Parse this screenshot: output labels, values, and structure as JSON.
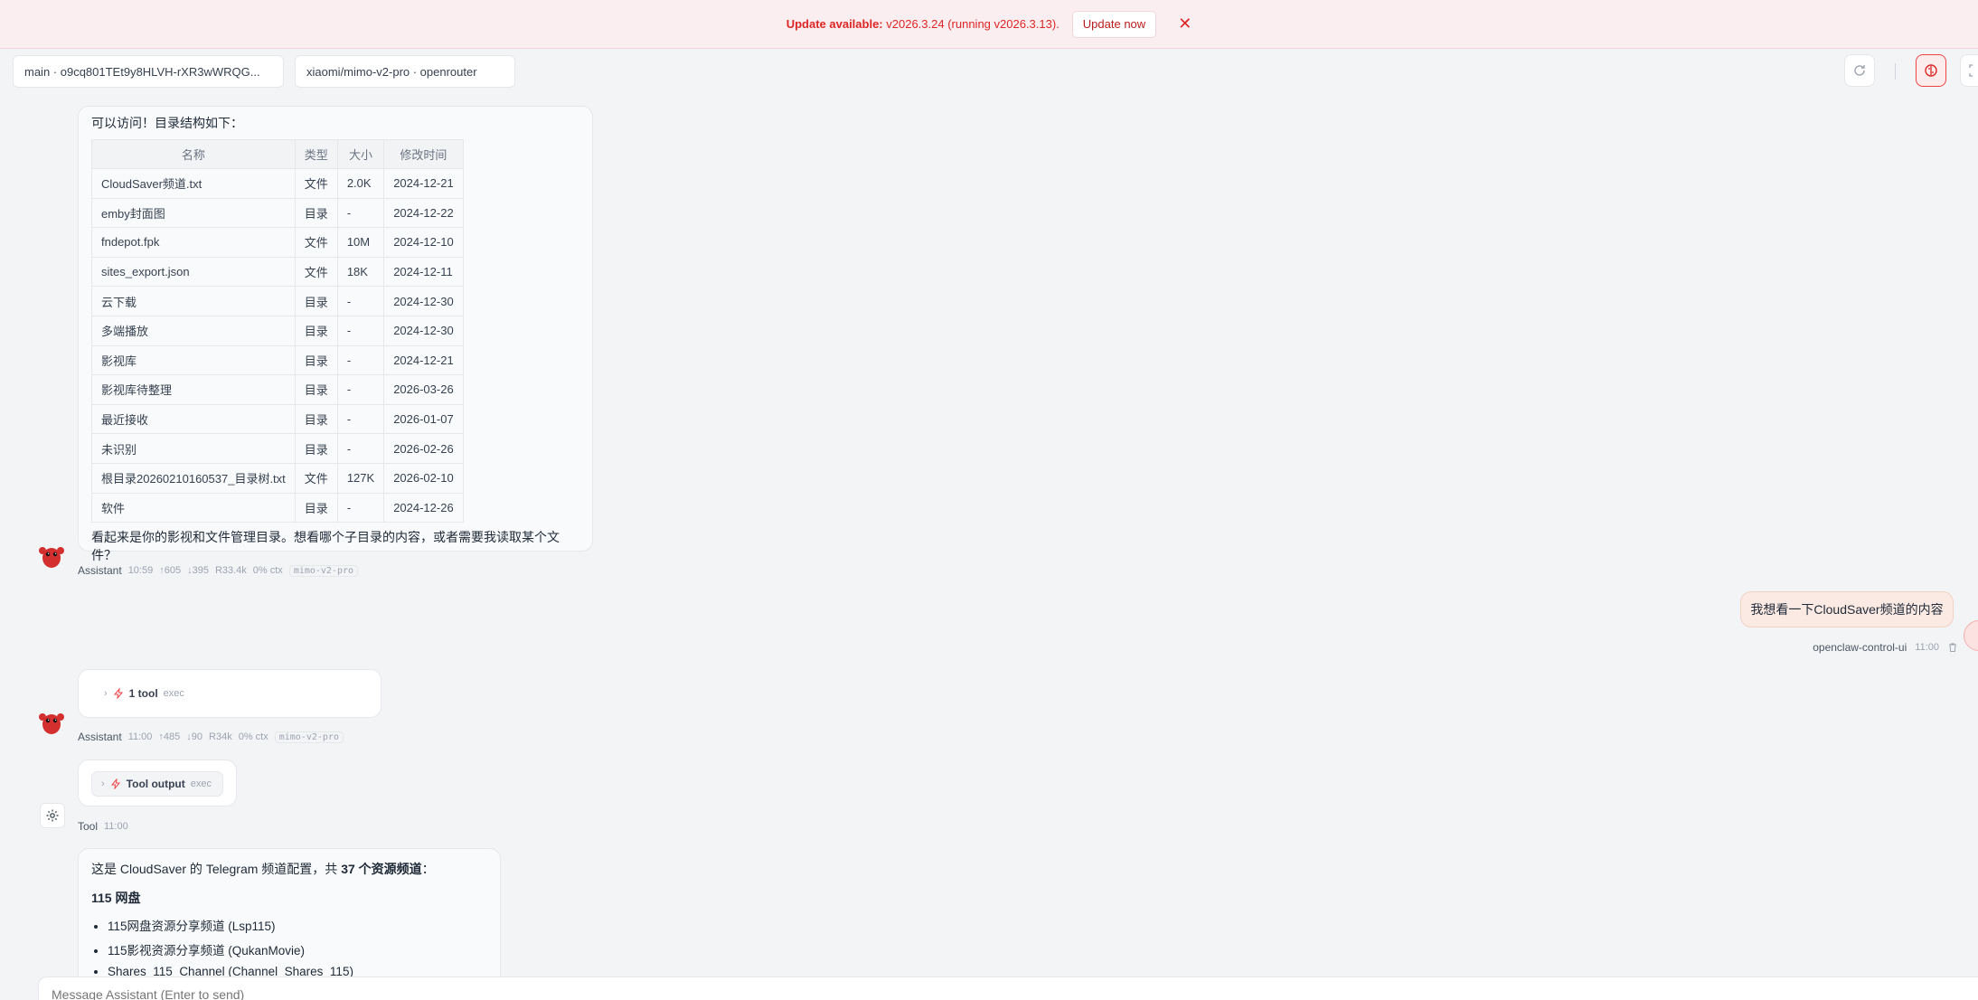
{
  "banner": {
    "label": "Update available:",
    "version_text": "v2026.3.24 (running v2026.3.13).",
    "button": "Update now",
    "close": "✕"
  },
  "topbar": {
    "session": "main · o9cq801TEt9y8HLVH-rXR3wWRQG...",
    "model": "xiaomi/mimo-v2-pro · openrouter"
  },
  "msg1": {
    "intro": "可以访问！目录结构如下：",
    "headers": [
      "名称",
      "类型",
      "大小",
      "修改时间"
    ],
    "rows": [
      [
        "CloudSaver频道.txt",
        "文件",
        "2.0K",
        "2024-12-21"
      ],
      [
        "emby封面图",
        "目录",
        "-",
        "2024-12-22"
      ],
      [
        "fndepot.fpk",
        "文件",
        "10M",
        "2024-12-10"
      ],
      [
        "sites_export.json",
        "文件",
        "18K",
        "2024-12-11"
      ],
      [
        "云下载",
        "目录",
        "-",
        "2024-12-30"
      ],
      [
        "多端播放",
        "目录",
        "-",
        "2024-12-30"
      ],
      [
        "影视库",
        "目录",
        "-",
        "2024-12-21"
      ],
      [
        "影视库待整理",
        "目录",
        "-",
        "2026-03-26"
      ],
      [
        "最近接收",
        "目录",
        "-",
        "2026-01-07"
      ],
      [
        "未识别",
        "目录",
        "-",
        "2026-02-26"
      ],
      [
        "根目录20260210160537_目录树.txt",
        "文件",
        "127K",
        "2026-02-10"
      ],
      [
        "软件",
        "目录",
        "-",
        "2024-12-26"
      ]
    ],
    "outro": "看起来是你的影视和文件管理目录。想看哪个子目录的内容，或者需要我读取某个文件？"
  },
  "meta1": {
    "who": "Assistant",
    "time": "10:59",
    "up": "↑605",
    "down": "↓395",
    "r": "R33.4k",
    "ctx": "0% ctx",
    "model": "mimo-v2-pro"
  },
  "user_msg": {
    "text": "我想看一下CloudSaver频道的内容",
    "who": "openclaw-control-ui",
    "time": "11:00"
  },
  "tool_call": {
    "caret": "›",
    "label": "1 tool",
    "sub": "exec"
  },
  "meta2": {
    "who": "Assistant",
    "time": "11:00",
    "up": "↑485",
    "down": "↓90",
    "r": "R34k",
    "ctx": "0% ctx",
    "model": "mimo-v2-pro"
  },
  "tool_output": {
    "caret": "›",
    "label": "Tool output",
    "sub": "exec"
  },
  "meta3": {
    "who": "Tool",
    "time": "11:00"
  },
  "msg3": {
    "intro_a": "这是 CloudSaver 的 Telegram 频道配置，共 ",
    "intro_b": "37 个资源频道",
    "intro_c": "：",
    "heading": "115 网盘",
    "items": [
      "115网盘资源分享频道 (Lsp115)",
      "115影视资源分享频道 (QukanMovie)",
      "Shares_115_Channel (Channel_Shares_115)"
    ]
  },
  "composer": {
    "placeholder": "Message Assistant (Enter to send)"
  },
  "colors": {
    "accent": "#dc2626",
    "banner_bg": "#fbeef0",
    "user_bubble": "#fbeae3"
  },
  "icons": [
    "close-icon",
    "refresh-icon",
    "brain-icon",
    "focus-icon",
    "lobster-avatar-icon",
    "bolt-icon",
    "gear-icon",
    "trash-icon"
  ]
}
